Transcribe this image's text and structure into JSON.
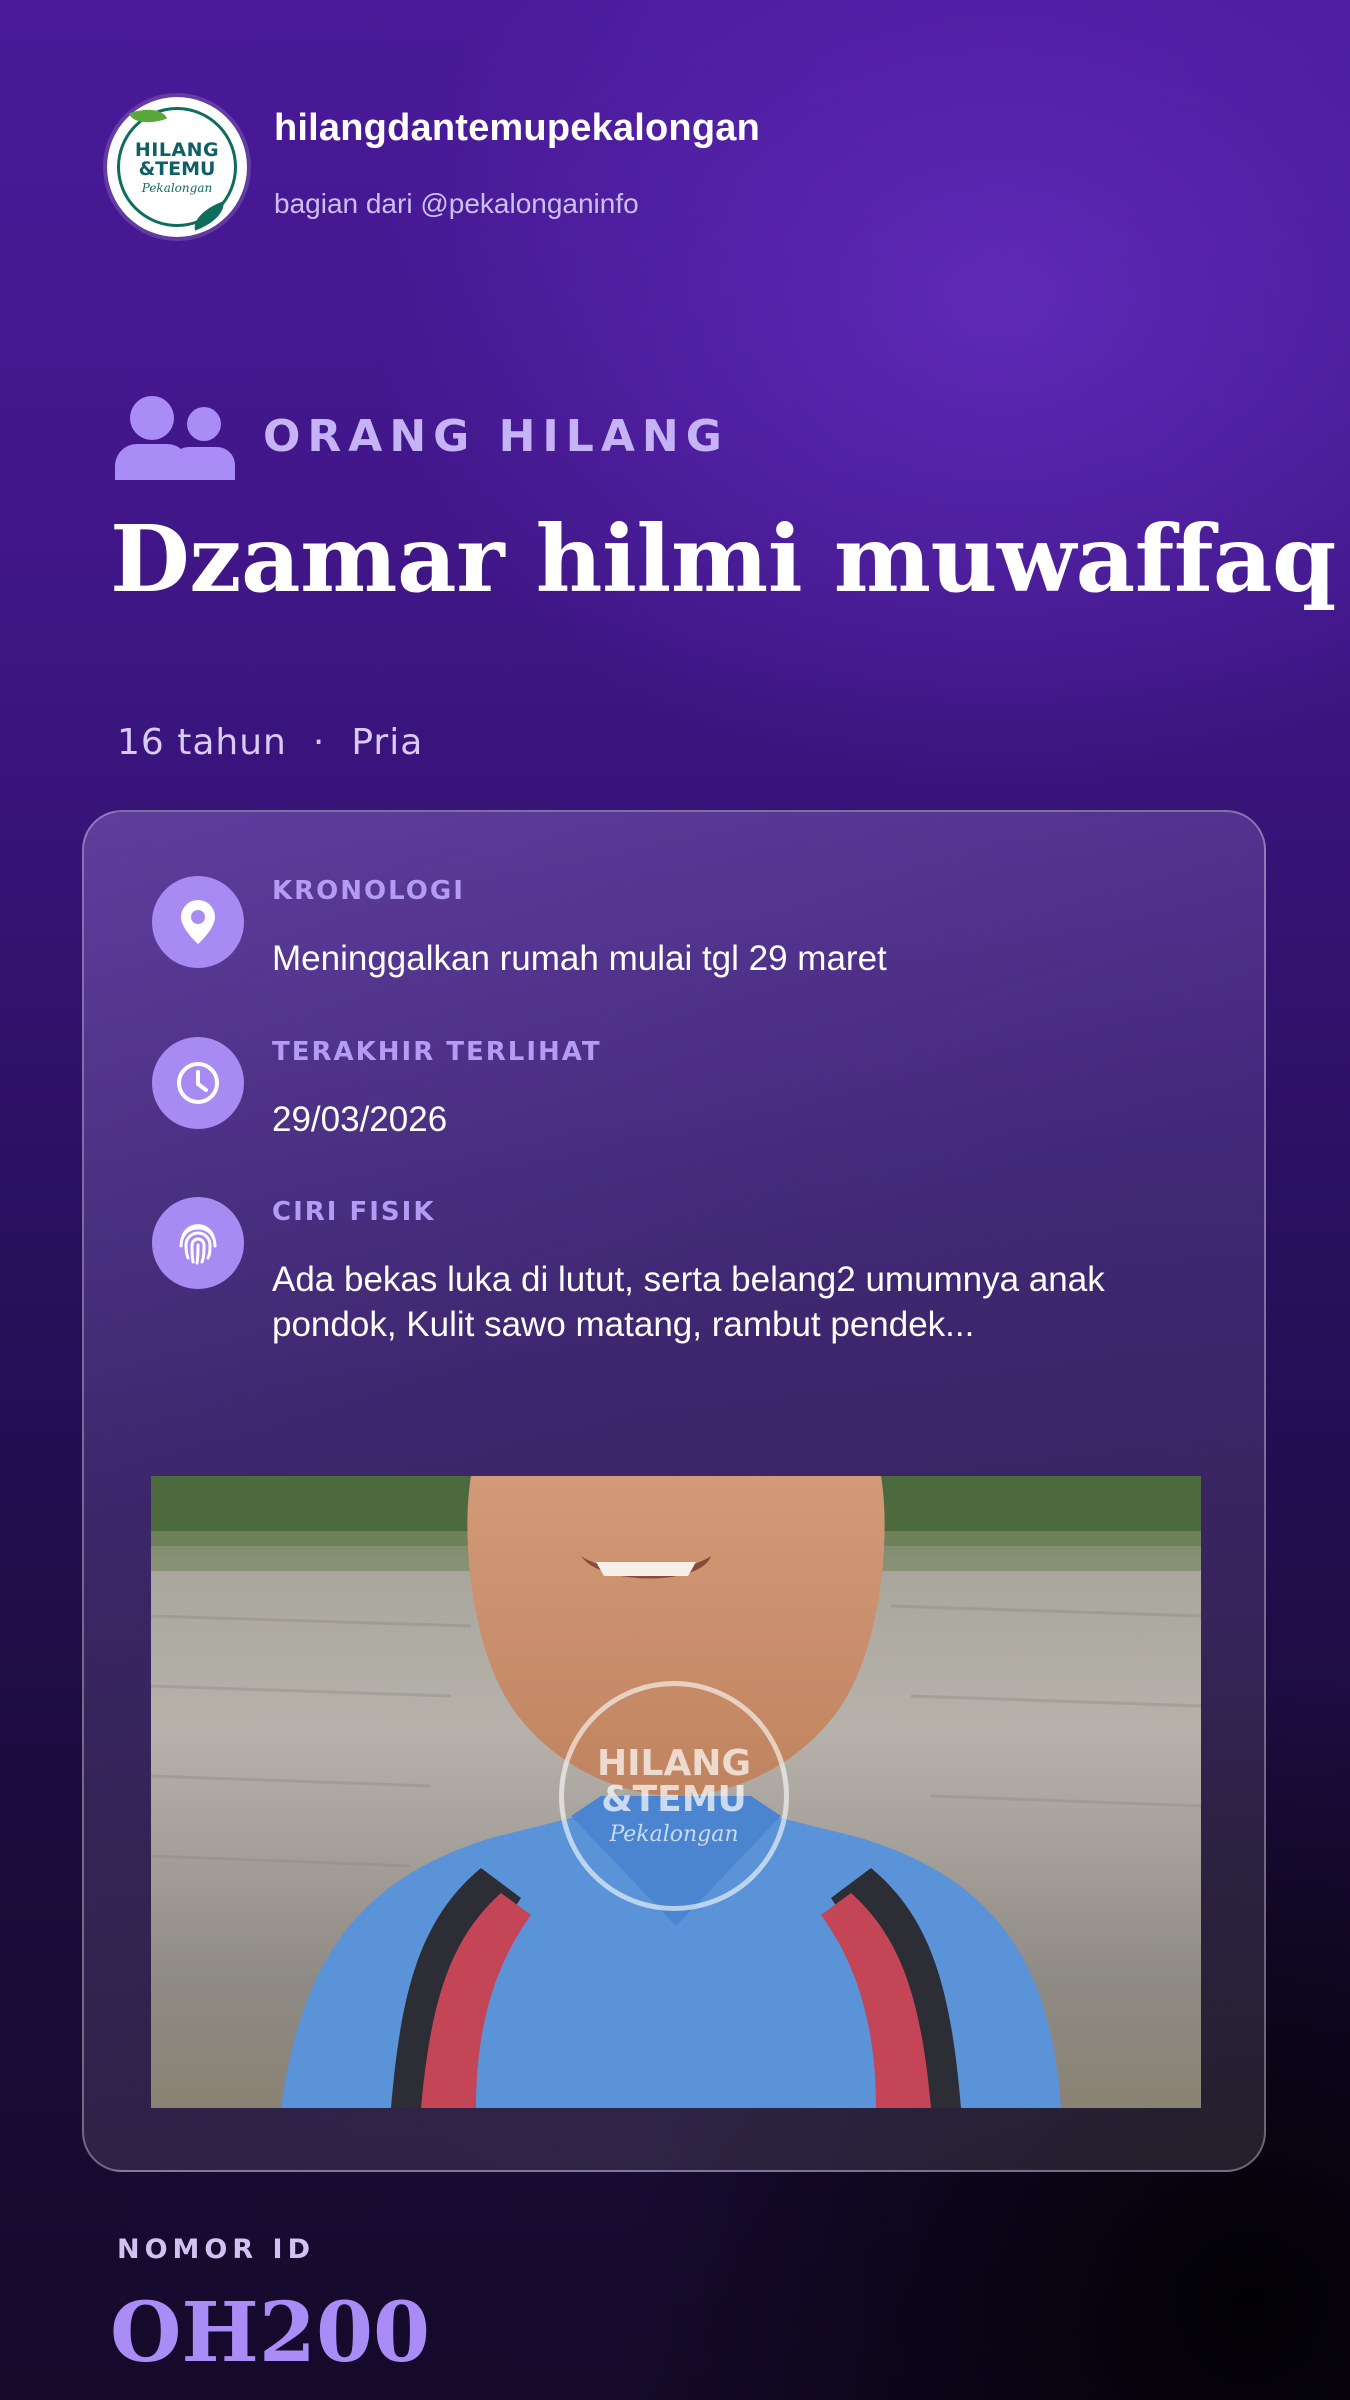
{
  "account": {
    "name": "hilangdantemupekalongan",
    "subtitle": "bagian dari @pekalonganinfo",
    "logo_text": [
      "HILANG",
      "&TEMU",
      "Pekalongan"
    ]
  },
  "category": {
    "icon": "users-icon",
    "label": "ORANG HILANG"
  },
  "person": {
    "name": "Dzamar hilmi muwaffaq",
    "age": "16 tahun",
    "separator": "·",
    "gender": "Pria"
  },
  "details": [
    {
      "icon": "map-pin-icon",
      "label": "KRONOLOGI",
      "value": "Meninggalkan rumah mulai tgl 29 maret"
    },
    {
      "icon": "clock-icon",
      "label": "TERAKHIR TERLIHAT",
      "value": "29/03/2026"
    },
    {
      "icon": "fingerprint-icon",
      "label": "CIRI FISIK",
      "value": "Ada bekas luka di lutut, serta belang2 umumnya anak pondok, Kulit sawo matang, rambut pendek..."
    }
  ],
  "photo": {
    "watermark_text": [
      "HILANG",
      "&TEMU",
      "Pekalongan"
    ]
  },
  "id_section": {
    "label": "NOMOR ID",
    "value": "OH200"
  },
  "colors": {
    "accent": "#a98cf5",
    "background_top": "#4a1a9a",
    "background_bottom": "#150a2a",
    "logo_teal": "#0f6d5e",
    "logo_green": "#5aa83a"
  }
}
